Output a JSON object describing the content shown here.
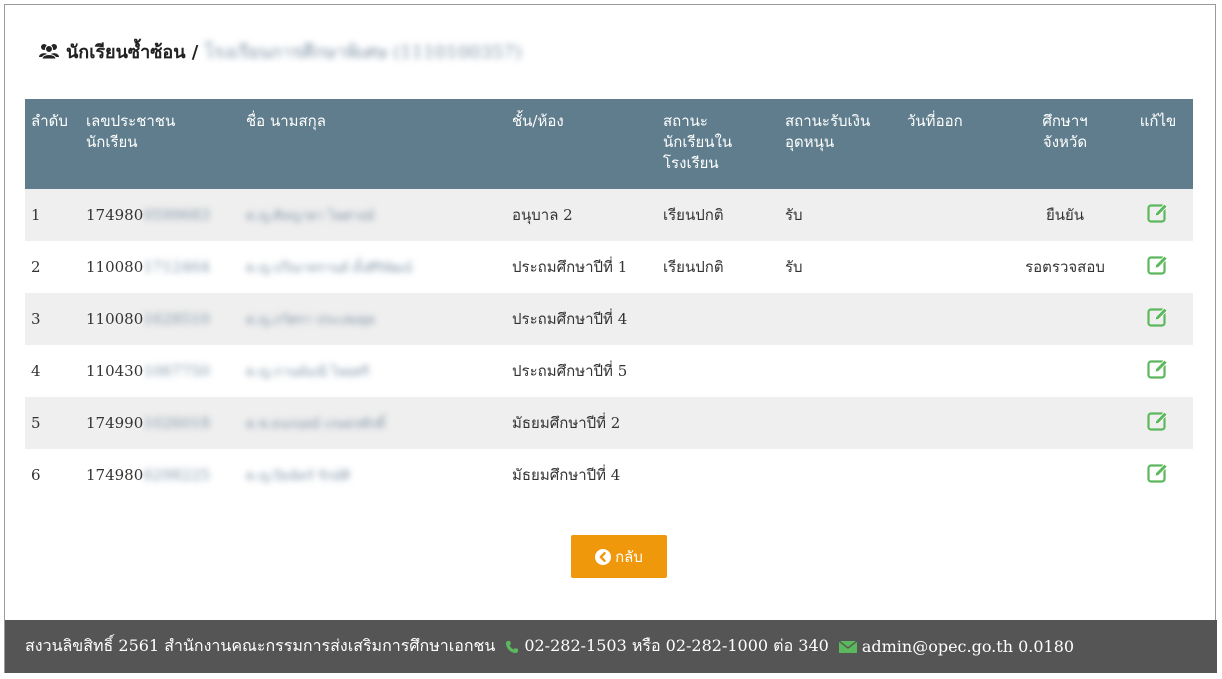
{
  "header": {
    "title": "นักเรียนซ้ำซ้อน /",
    "school_name_blurred": "โรงเรียนการศึกษาพิเศษ (1110100357)"
  },
  "table": {
    "columns": [
      {
        "key": "no",
        "label": "ลำดับ"
      },
      {
        "key": "id",
        "label": "เลขประชาชน\nนักเรียน"
      },
      {
        "key": "name",
        "label": "ชื่อ นามสกุล"
      },
      {
        "key": "class",
        "label": "ชั้น/ห้อง"
      },
      {
        "key": "status",
        "label": "สถานะ\nนักเรียนใน\nโรงเรียน"
      },
      {
        "key": "subsidy",
        "label": "สถานะรับเงิน\nอุดหนุน"
      },
      {
        "key": "leave_date",
        "label": "วันที่ออก"
      },
      {
        "key": "province",
        "label": "ศึกษาฯ\nจังหวัด"
      },
      {
        "key": "edit",
        "label": "แก้ไข"
      }
    ],
    "rows": [
      {
        "no": "1",
        "id_prefix": "174980",
        "id_blur": "0599683",
        "name_blur": "ด.ญ.ศิลญาดา ไพศาลย์",
        "class": "อนุบาล 2",
        "status": "เรียนปกติ",
        "subsidy": "รับ",
        "leave_date": "",
        "province": "ยืนยัน"
      },
      {
        "no": "2",
        "id_prefix": "110080",
        "id_blur": "1712464",
        "name_blur": "ด.ญ.ปวีณาทรานต์ ตั้งศิริพัฒน์",
        "class": "ประถมศึกษาปีที่ 1",
        "status": "เรียนปกติ",
        "subsidy": "รับ",
        "leave_date": "",
        "province": "รอตรวจสอบ"
      },
      {
        "no": "3",
        "id_prefix": "110080",
        "id_blur": "1628510",
        "name_blur": "ด.ญ.ภวิศรา ประเสมฐุต",
        "class": "ประถมศึกษาปีที่ 4",
        "status": "",
        "subsidy": "",
        "leave_date": "",
        "province": ""
      },
      {
        "no": "4",
        "id_prefix": "110430",
        "id_blur": "1067750",
        "name_blur": "ด.ญ.กานต์มณี ไพยศรี",
        "class": "ประถมศึกษาปีที่ 5",
        "status": "",
        "subsidy": "",
        "leave_date": "",
        "province": ""
      },
      {
        "no": "5",
        "id_prefix": "174990",
        "id_blur": "1026018",
        "name_blur": "ด.ช.ธนกฤตย์ เกษตรศักดิ์",
        "class": "มัธยมศึกษาปีที่ 2",
        "status": "",
        "subsidy": "",
        "leave_date": "",
        "province": ""
      },
      {
        "no": "6",
        "id_prefix": "174980",
        "id_blur": "6298225",
        "name_blur": "ด.ญ.ปิยฉัตร์ รักษ์ศิ",
        "class": "มัธยมศึกษาปีที่ 4",
        "status": "",
        "subsidy": "",
        "leave_date": "",
        "province": ""
      }
    ]
  },
  "back_button": {
    "label": "กลับ",
    "icon": "chevron-left-circle-icon"
  },
  "footer": {
    "copyright": "สงวนลิขสิทธิ์ 2561 สำนักงานคณะกรรมการส่งเสริมการศึกษาเอกชน",
    "phone": "02-282-1503 หรือ 02-282-1000 ต่อ 340",
    "email": "admin@opec.go.th 0.0180"
  },
  "colors": {
    "table_header": "#5f7d8c",
    "row_stripe": "#efefef",
    "edit_icon": "#5cb85c",
    "back_button": "#f0980c",
    "footer_bg": "#555555"
  }
}
